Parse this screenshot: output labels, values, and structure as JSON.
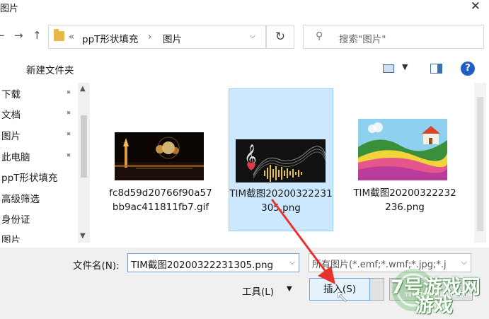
{
  "window": {
    "title": "图片",
    "close_glyph": "✕"
  },
  "nav": {
    "back_glyph": "←",
    "forward_glyph": "→",
    "up_glyph": "↑",
    "breadcrumb_sep": "«",
    "path": [
      "ppT形状填充",
      "图片"
    ],
    "path_sep": "›",
    "refresh_glyph": "↻",
    "search_placeholder": "搜索\"图片\""
  },
  "toolbar": {
    "new_folder": "新建文件夹",
    "help": "?"
  },
  "sidebar": {
    "items": [
      {
        "label": "下载",
        "pinned": true
      },
      {
        "label": "文档",
        "pinned": true
      },
      {
        "label": "图片",
        "pinned": true
      },
      {
        "label": "此电脑",
        "pinned": true
      },
      {
        "label": "ppT形状填充",
        "pinned": false
      },
      {
        "label": "高级筛选",
        "pinned": false
      },
      {
        "label": "身份证",
        "pinned": false
      },
      {
        "label": "图片",
        "pinned": false
      }
    ],
    "pin_glyph": "📌"
  },
  "files": [
    {
      "name": "fc8d59d20766f90a57bb9ac411811fb7.gif",
      "selected": false
    },
    {
      "name": "TIM截图20200322231305.png",
      "selected": true
    },
    {
      "name": "TIM截图20200322232236.png",
      "selected": false
    }
  ],
  "footer": {
    "filename_label": "文件名(N):",
    "filename_value": "TIM截图20200322231305.png",
    "filetype_value": "所有图片(*.emf;*.wmf;*.jpg;*.j",
    "tools_label": "工具(L)",
    "insert_label": "插入(S)"
  },
  "watermark": {
    "brand_line1": "7号游戏网",
    "brand_line2": "游戏",
    "url": "YIHAOYOUXIWANG.COM"
  },
  "colors": {
    "selection_bg": "#cce8ff",
    "selection_border": "#99d1ff",
    "arrow": "#e8322e",
    "accent": "#1f5fbf"
  }
}
